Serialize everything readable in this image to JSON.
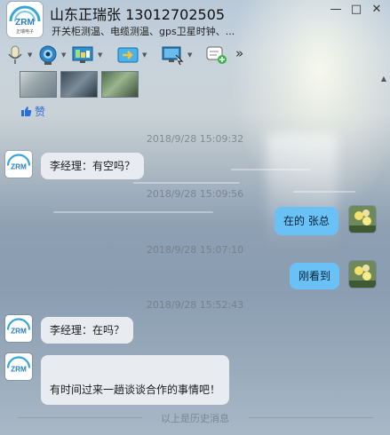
{
  "header": {
    "title": "山东正瑞张 13012702505",
    "subtitle": "开关柜测温、电缆测温、gps卫星时钟、...",
    "avatar_text": "ZRM",
    "avatar_subtext": "正瑞电子"
  },
  "window_controls": {
    "minimize": "—",
    "maximize": "□",
    "close": "✕"
  },
  "toolbar": {
    "more": "»",
    "icons": [
      "mic-icon",
      "video-camera-icon",
      "screen-share-icon",
      "file-transfer-icon",
      "remote-desktop-icon",
      "add-app-icon"
    ]
  },
  "shared": {
    "like_label": "赞"
  },
  "messages": [
    {
      "type": "timestamp",
      "text": "2018/9/28 15:09:32"
    },
    {
      "type": "incoming",
      "text": "李经理：有空吗？"
    },
    {
      "type": "timestamp",
      "text": "2018/9/28 15:09:56"
    },
    {
      "type": "outgoing",
      "text": "在的 张总"
    },
    {
      "type": "timestamp",
      "text": "2018/9/28 15:07:10"
    },
    {
      "type": "outgoing",
      "text": "刚看到"
    },
    {
      "type": "timestamp",
      "text": "2018/9/28 15:52:43"
    },
    {
      "type": "incoming",
      "text": "李经理：在吗？"
    },
    {
      "type": "incoming",
      "text": "有时间过来一趟谈谈合作的事情吧！"
    }
  ],
  "footer": {
    "history_link": "以上是历史消息"
  },
  "colors": {
    "outgoing_bubble": "#69c1f5",
    "incoming_bubble": "#e8ecf0",
    "like_link": "#2b6fd6"
  }
}
